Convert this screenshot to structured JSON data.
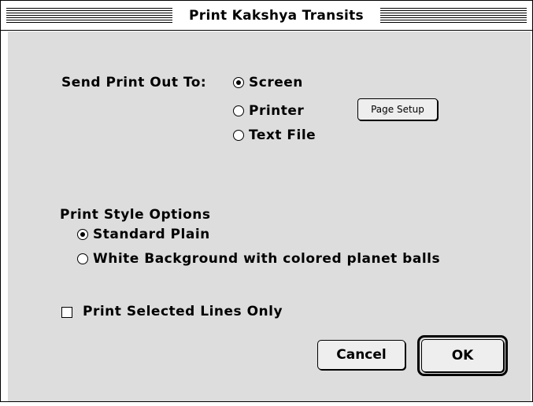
{
  "window": {
    "title": "Print Kakshya Transits"
  },
  "output": {
    "label": "Send Print Out To:",
    "options": [
      {
        "label": "Screen",
        "selected": true
      },
      {
        "label": "Printer",
        "selected": false
      },
      {
        "label": "Text File",
        "selected": false
      }
    ],
    "page_setup_label": "Page Setup"
  },
  "style": {
    "heading": "Print Style Options",
    "options": [
      {
        "label": "Standard Plain",
        "selected": true
      },
      {
        "label": "White Background with colored planet balls",
        "selected": false
      }
    ]
  },
  "selected_lines": {
    "label": "Print Selected Lines Only",
    "checked": false
  },
  "buttons": {
    "cancel": "Cancel",
    "ok": "OK"
  }
}
